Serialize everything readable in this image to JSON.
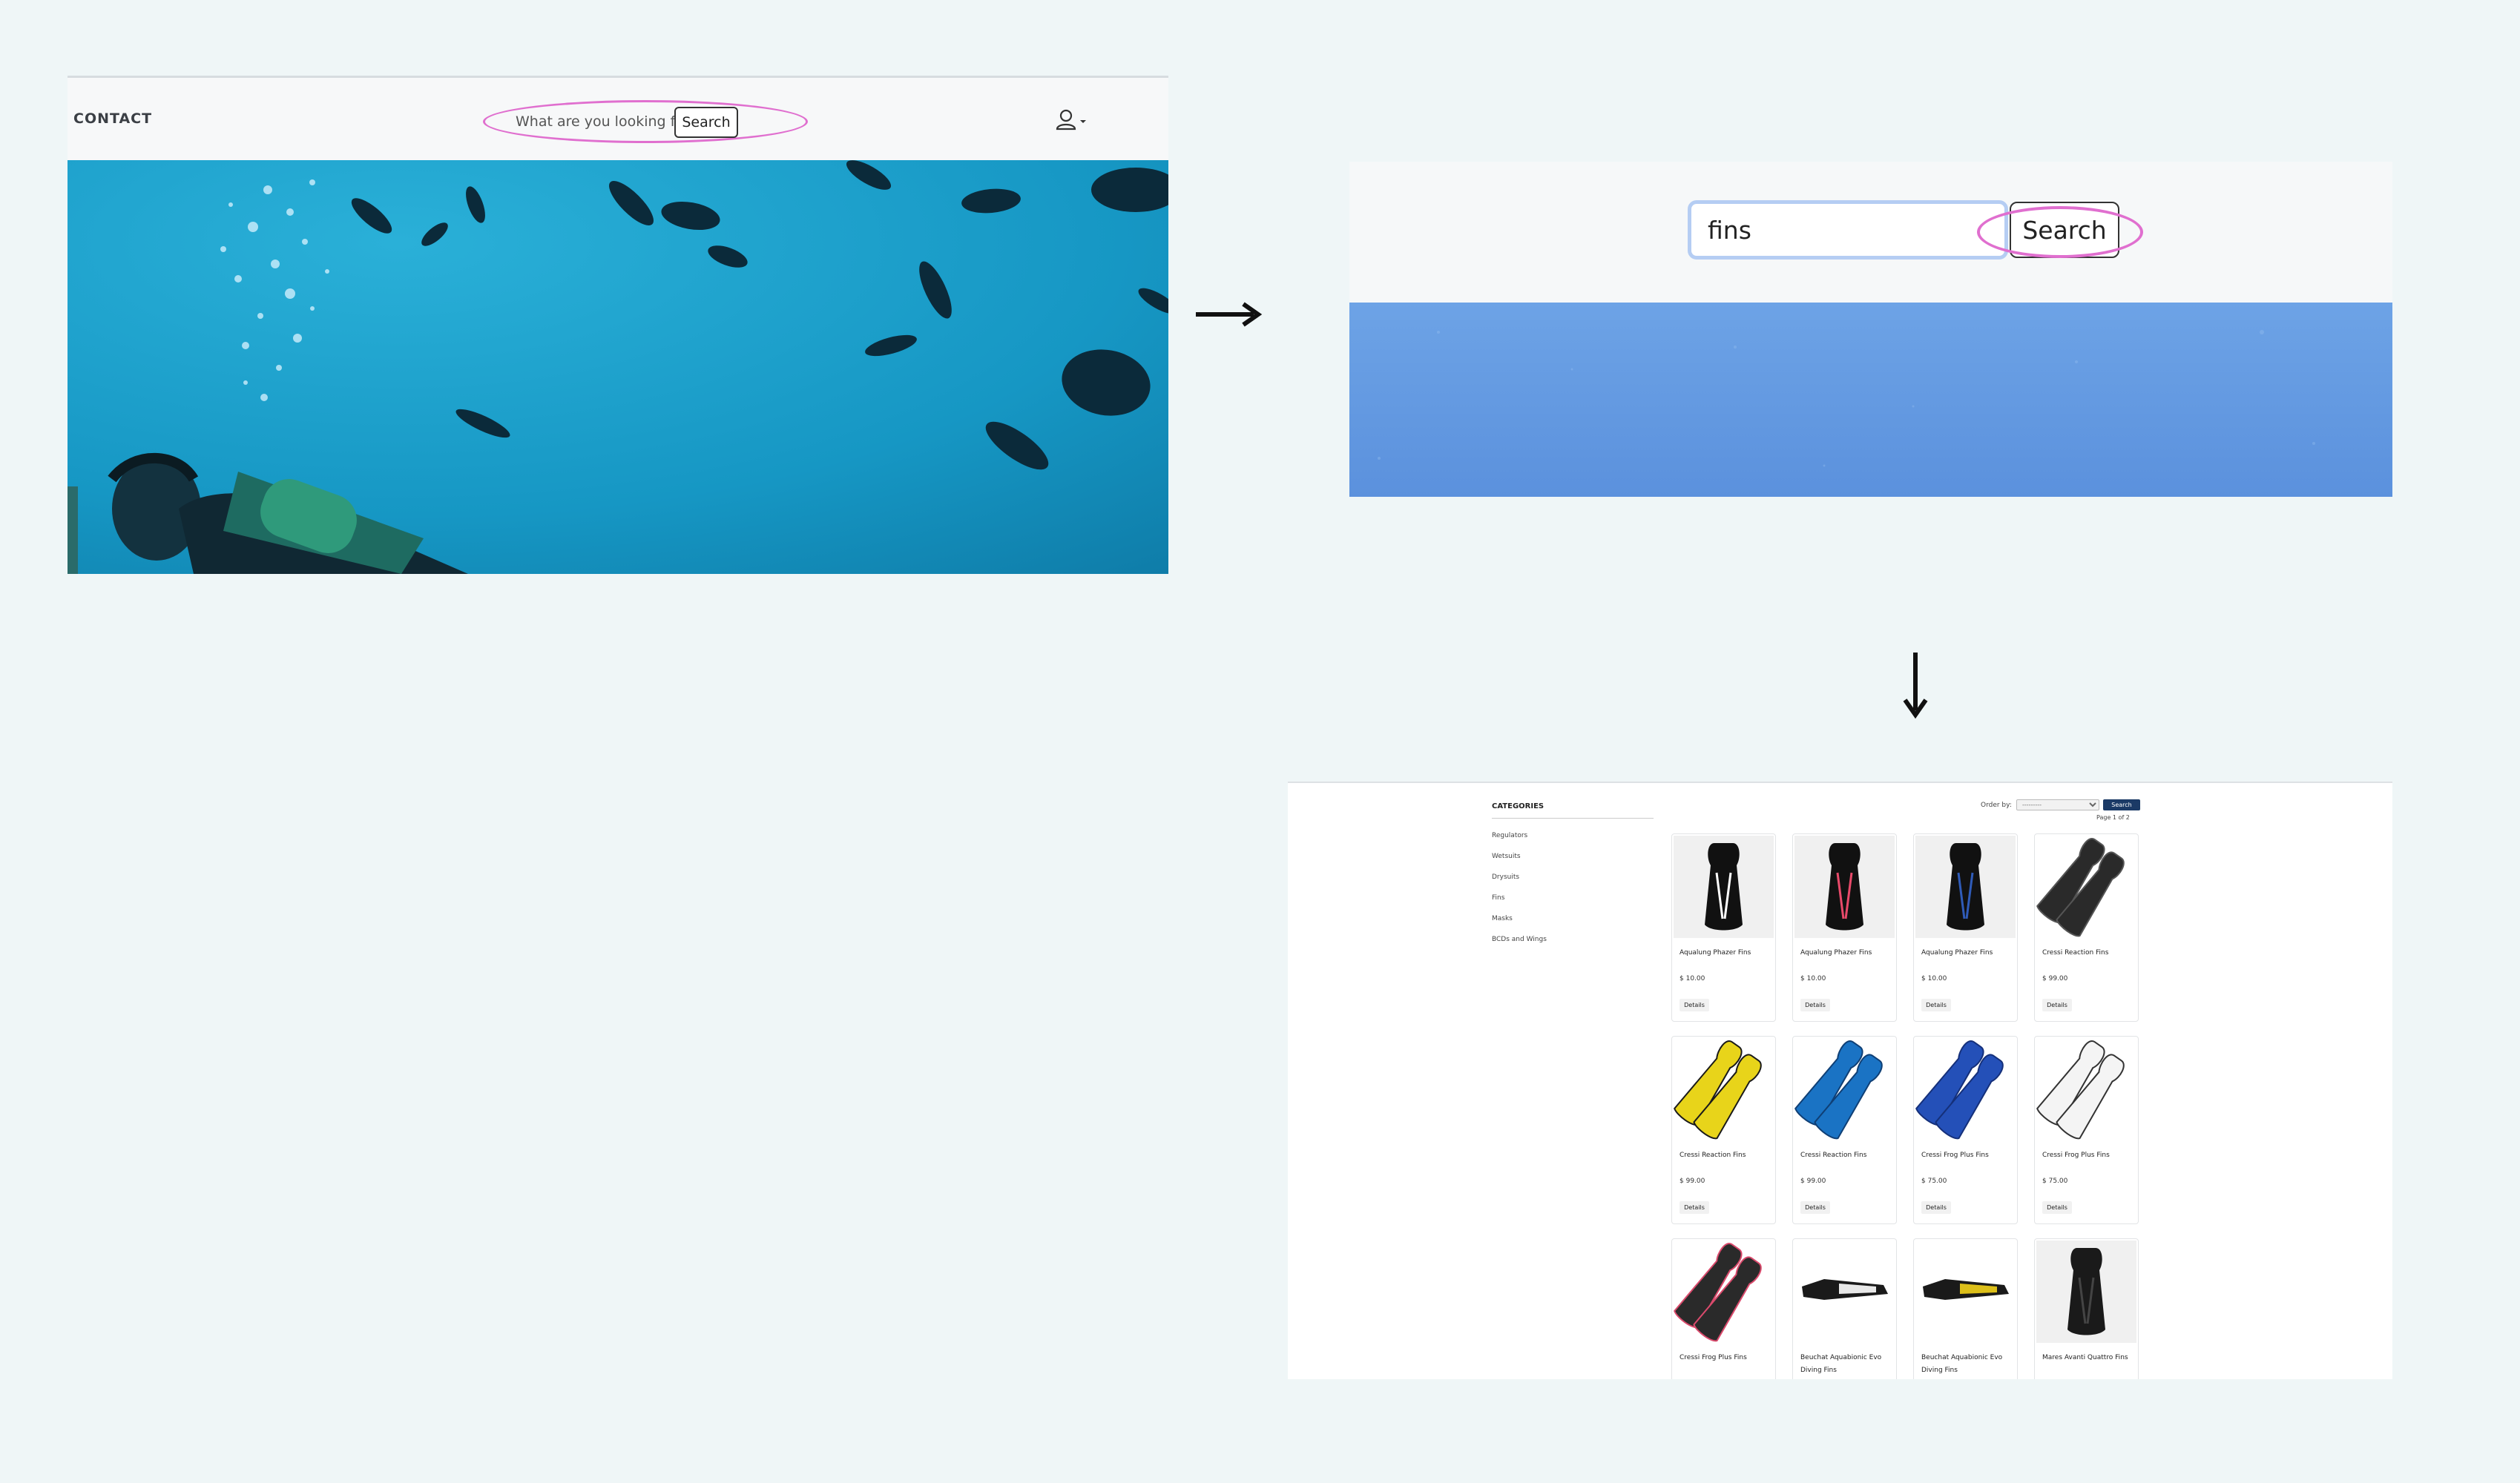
{
  "panel1": {
    "nav_contact": "CONTACT",
    "search_placeholder": "What are you looking for?",
    "search_button": "Search",
    "user_icon": "user-icon"
  },
  "panel2": {
    "search_value": "fins",
    "search_button": "Search"
  },
  "panel3": {
    "categories_title": "CATEGORIES",
    "categories": [
      "Regulators",
      "Wetsuits",
      "Drysuits",
      "Fins",
      "Masks",
      "BCDs and Wings"
    ],
    "order_by_label": "Order by:",
    "order_by_value": "---------",
    "search_button": "Search",
    "page_info": "Page 1 of 2",
    "details_label": "Details",
    "products": [
      {
        "name": "Aqualung Phazer Fins",
        "price": "$ 10.00",
        "color": "#111111",
        "accent": "#ffffff"
      },
      {
        "name": "Aqualung Phazer Fins",
        "price": "$ 10.00",
        "color": "#111111",
        "accent": "#e84a6a"
      },
      {
        "name": "Aqualung Phazer Fins",
        "price": "$ 10.00",
        "color": "#111111",
        "accent": "#2f5bb8"
      },
      {
        "name": "Cressi Reaction Fins",
        "price": "$ 99.00",
        "color": "#2a2a2a",
        "accent": "#555555"
      },
      {
        "name": "Cressi Reaction Fins",
        "price": "$ 99.00",
        "color": "#e8d41a",
        "accent": "#1a1a1a"
      },
      {
        "name": "Cressi Reaction Fins",
        "price": "$ 99.00",
        "color": "#1a73c4",
        "accent": "#0f3f75"
      },
      {
        "name": "Cressi Frog Plus Fins",
        "price": "$ 75.00",
        "color": "#2450b8",
        "accent": "#15307a"
      },
      {
        "name": "Cressi Frog Plus Fins",
        "price": "$ 75.00",
        "color": "#f4f4f4",
        "accent": "#333333"
      },
      {
        "name": "Cressi Frog Plus Fins",
        "price": "",
        "color": "#2a2a2a",
        "accent": "#d94a6c"
      },
      {
        "name": "Beuchat Aquabionic Evo Diving Fins",
        "price": "",
        "color": "#1a1a1a",
        "accent": "#ffffff"
      },
      {
        "name": "Beuchat Aquabionic Evo Diving Fins",
        "price": "",
        "color": "#1a1a1a",
        "accent": "#f2d21a"
      },
      {
        "name": "Mares Avanti Quattro Fins",
        "price": "",
        "color": "#1a1a1a",
        "accent": "#444444"
      }
    ]
  },
  "colors": {
    "page_bg": "#eff6f7",
    "highlight": "#e06fcf",
    "ocean": "#1f9ac7",
    "search_btn_dark": "#1b3a66"
  }
}
